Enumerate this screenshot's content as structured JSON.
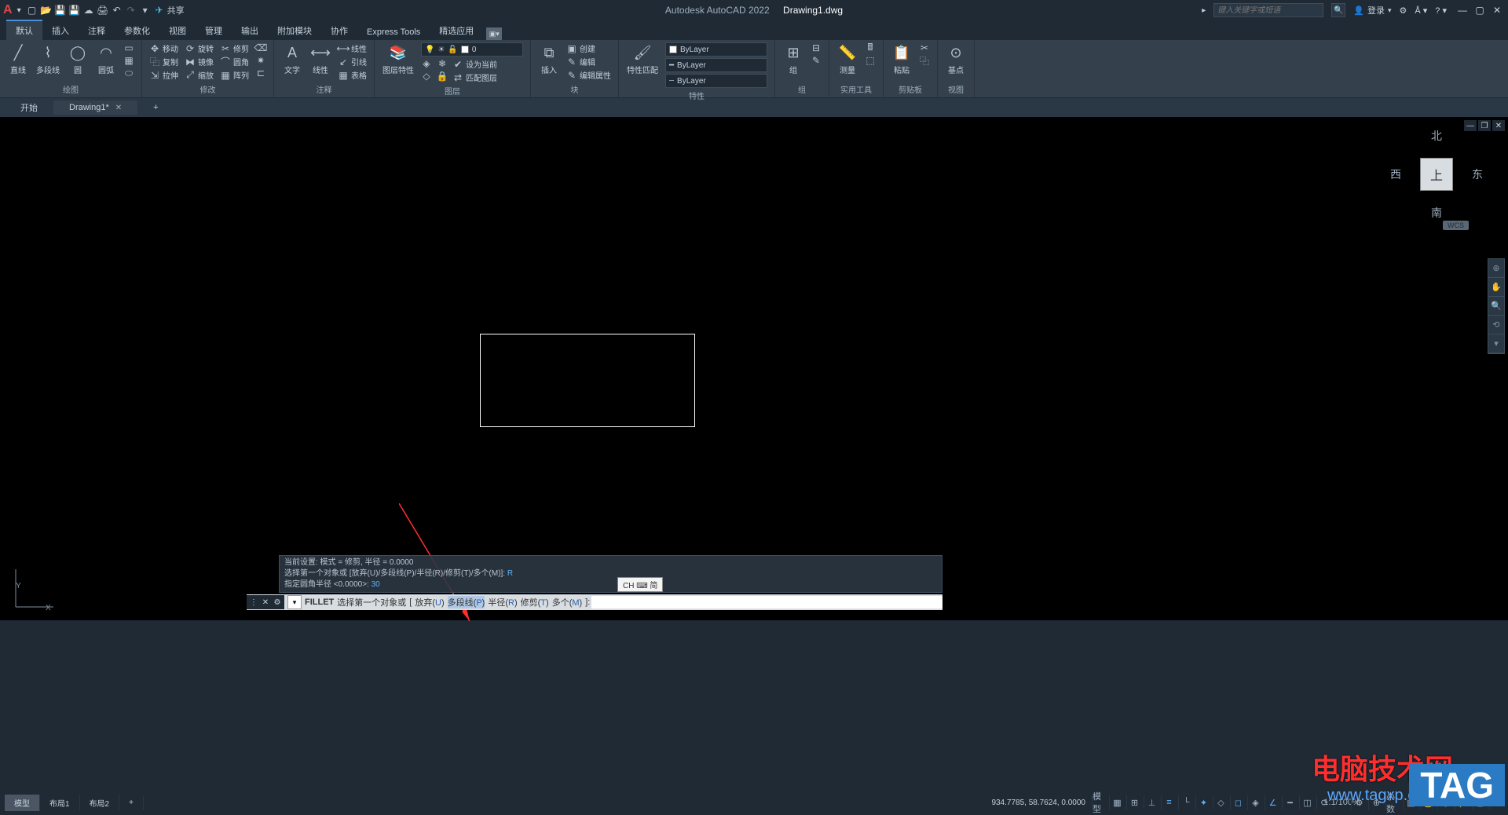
{
  "app_name": "Autodesk AutoCAD 2022",
  "document_name": "Drawing1.dwg",
  "logo_letter": "A",
  "share_label": "共享",
  "search_placeholder": "键入关键字或短语",
  "login_label": "登录",
  "ribbon_tabs": [
    "默认",
    "插入",
    "注释",
    "参数化",
    "视图",
    "管理",
    "输出",
    "附加模块",
    "协作",
    "Express Tools",
    "精选应用"
  ],
  "draw": {
    "line": "直线",
    "polyline": "多段线",
    "circle": "圆",
    "arc": "圆弧",
    "title": "绘图"
  },
  "modify": {
    "move": "移动",
    "rotate": "旋转",
    "trim": "修剪",
    "copy": "复制",
    "mirror": "镜像",
    "fillet": "圆角",
    "stretch": "拉伸",
    "scale": "缩放",
    "array": "阵列",
    "title": "修改"
  },
  "annot": {
    "text": "文字",
    "dim_linear": "线性",
    "leader": "引线",
    "table": "表格",
    "title": "注释"
  },
  "layers": {
    "props": "图层特性",
    "current": "设为当前",
    "match": "匹配图层",
    "title": "图层",
    "name": "0"
  },
  "block": {
    "insert": "插入",
    "create": "创建",
    "edit": "编辑",
    "editattr": "编辑属性",
    "title": "块"
  },
  "props": {
    "match": "特性匹配",
    "bylayer": "ByLayer",
    "title": "特性"
  },
  "group": {
    "group": "组",
    "title": "组"
  },
  "util": {
    "measure": "测量",
    "title": "实用工具"
  },
  "clip": {
    "paste": "粘贴",
    "title": "剪贴板"
  },
  "view": {
    "base": "基点",
    "title": "视图"
  },
  "doc_tabs": {
    "start": "开始",
    "drawing": "Drawing1*"
  },
  "layout_tabs": {
    "model": "模型",
    "l1": "布局1",
    "l2": "布局2"
  },
  "viewcube": {
    "top": "上",
    "n": "北",
    "s": "南",
    "e": "东",
    "w": "西",
    "wcs": "WCS"
  },
  "ucs": {
    "x": "X",
    "y": "Y"
  },
  "cmd_history": {
    "l1_a": "当前设置: 模式 = 修剪, 半径 = 0.0000",
    "l2_a": "选择第一个对象或 [放弃(U)/多段线(P)/半径(R)/修剪(T)/多个(M)]:",
    "l2_b": "R",
    "l3_a": "指定圆角半径 <0.0000>:",
    "l3_b": "30"
  },
  "cmd": {
    "name": "FILLET",
    "prompt": "选择第一个对象或",
    "opts": {
      "undo": "放弃(",
      "undo_k": "U",
      "undo_c": ")",
      "poly": "多段线(",
      "poly_k": "P",
      "poly_c": ")",
      "rad": "半径(",
      "rad_k": "R",
      "rad_c": ")",
      "trim": "修剪(",
      "trim_k": "T",
      "trim_c": ")",
      "mult": "多个(",
      "mult_k": "M",
      "mult_c": ")"
    },
    "end": "]:"
  },
  "ime": "CH ⌨ 简",
  "status": {
    "coords": "934.7785, 58.7624, 0.0000",
    "model": "模型",
    "scale": "1:1/100%",
    "dec": "小数"
  },
  "watermark": {
    "w1": "电脑技术网",
    "w2": "TAG",
    "url": "www.tagxp.com"
  }
}
